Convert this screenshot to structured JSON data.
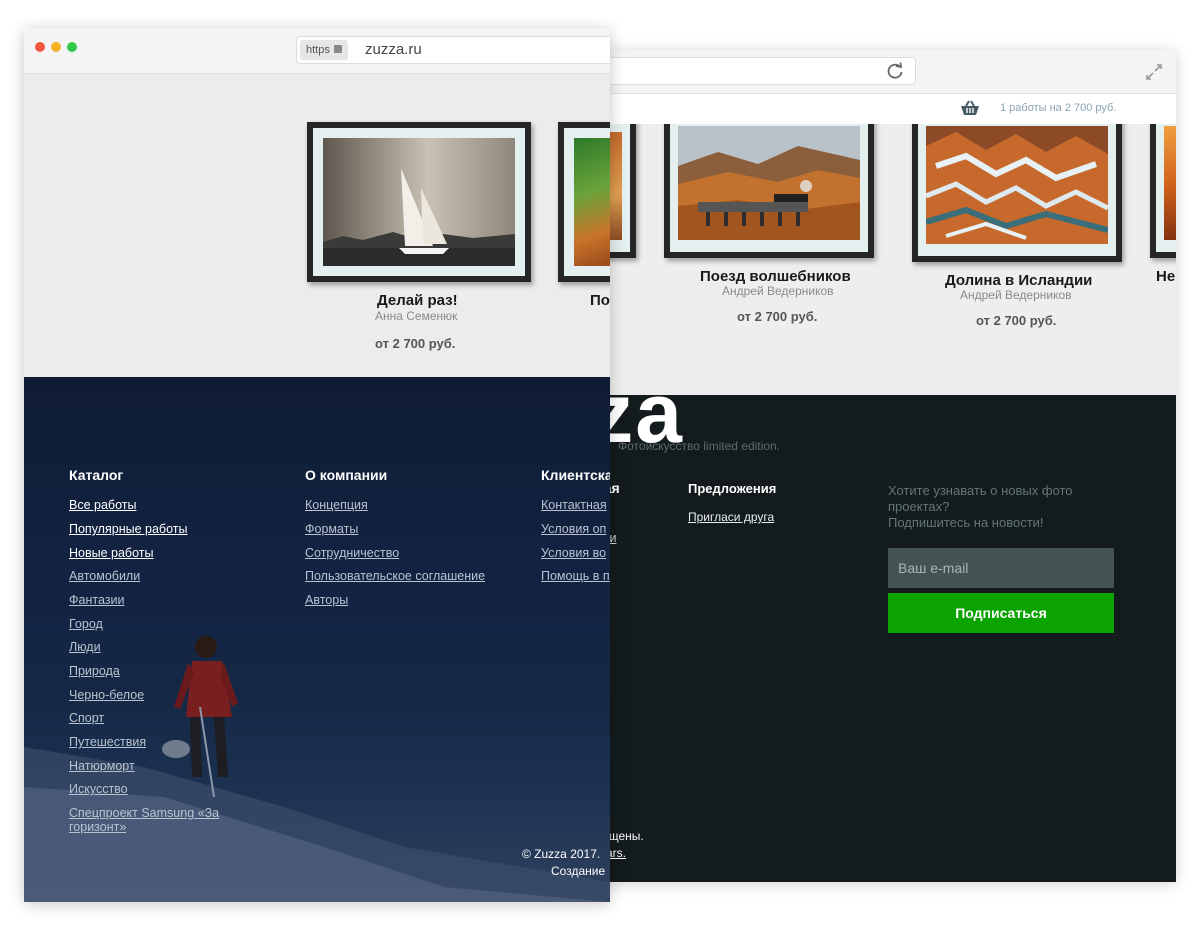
{
  "back_window": {
    "cart_text": "1 работы на 2 700 руб.",
    "works": [
      {
        "title": "Поезд волшебников",
        "author": "Андрей Ведерников",
        "price": "от 2 700 руб."
      },
      {
        "title": "Долина в Исландии",
        "author": "Андрей Ведерников",
        "price": "от 2 700 руб."
      },
      {
        "title": "Не"
      }
    ],
    "footer": {
      "logo": "zuzza",
      "tagline": "Фотоискусство limited edition.",
      "column_fragment": "Клиентская",
      "client_links_fragment": [
        "ки"
      ],
      "offers_heading": "Предложения",
      "offers_links": [
        "Пригласи друга"
      ],
      "subscribe_question": "Хотите узнавать о новых фото проектах?",
      "subscribe_prompt": "Подпишитесь на новости!",
      "email_placeholder": "Ваш e-mail",
      "subscribe_button": "Подписаться",
      "copyright_tail": "ищены.",
      "creator_tail": "ars."
    },
    "icons": [
      "reload-icon",
      "expand-icon",
      "cart-icon"
    ]
  },
  "front_window": {
    "https_label": "https",
    "domain": "zuzza.ru",
    "traffic_lights": [
      "#f05b3f",
      "#f5b023",
      "#33c748"
    ],
    "works": [
      {
        "title": "Делай раз!",
        "author": "Анна Семенюк",
        "price": "от 2 700 руб."
      },
      {
        "title": "По"
      }
    ],
    "footer": {
      "catalog": {
        "heading": "Каталог",
        "links": [
          "Все работы",
          "Популярные работы",
          "Новые работы",
          "Автомобили",
          "Фантазии",
          "Город",
          "Люди",
          "Природа",
          "Черно-белое",
          "Спорт",
          "Путешествия",
          "Натюрморт",
          "Искусство",
          "Спецпроект Samsung «За горизонт»"
        ]
      },
      "company": {
        "heading": "О компании",
        "links": [
          "Концепция",
          "Форматы",
          "Сотрудничество",
          "Пользовательское соглашение",
          "Авторы"
        ]
      },
      "client": {
        "heading": "Клиентска",
        "links": [
          "Контактная",
          "Условия оп",
          "Условия во",
          "Помощь в п"
        ]
      },
      "copyright": "© Zuzza 2017.",
      "creator": "Создание"
    }
  }
}
